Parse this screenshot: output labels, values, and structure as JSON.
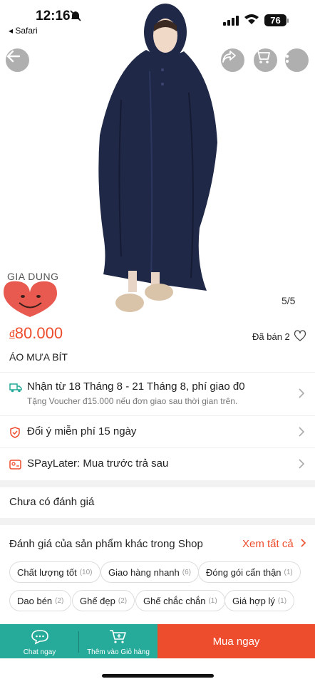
{
  "status_bar": {
    "time": "12:16",
    "back_app": "◂ Safari",
    "battery": "76"
  },
  "gallery": {
    "counter": "5/5",
    "watermark": "GIA DUNG"
  },
  "product": {
    "currency": "đ",
    "price": "80.000",
    "sold": "Đã bán 2",
    "name": "ÁO MƯA BÍT"
  },
  "shipping": {
    "title": "Nhận từ 18 Tháng 8 - 21 Tháng 8, phí giao đ0",
    "subtitle": "Tặng Voucher đ15.000 nếu đơn giao sau thời gian trên."
  },
  "return_policy": "Đổi ý miễn phí 15 ngày",
  "spaylater": "SPayLater: Mua trước trả sau",
  "reviews": {
    "none": "Chưa có đánh giá"
  },
  "shop_reviews": {
    "title": "Đánh giá của sản phẩm khác trong Shop",
    "see_all": "Xem tất cả",
    "chips": [
      {
        "label": "Chất lượng tốt",
        "count": "(10)"
      },
      {
        "label": "Giao hàng nhanh",
        "count": "(6)"
      },
      {
        "label": "Đóng gói cẩn thận",
        "count": "(1)"
      },
      {
        "label": "Dao bén",
        "count": "(2)"
      },
      {
        "label": "Ghế đẹp",
        "count": "(2)"
      },
      {
        "label": "Ghế chắc chắn",
        "count": "(1)"
      },
      {
        "label": "Giá hợp lý",
        "count": "(1)"
      }
    ]
  },
  "bottom_bar": {
    "chat": "Chat ngay",
    "add_cart": "Thêm vào Giỏ hàng",
    "buy_now": "Mua ngay"
  },
  "colors": {
    "accent": "#ee4d2d",
    "teal": "#26aa99",
    "raincoat": "#1f2846"
  }
}
